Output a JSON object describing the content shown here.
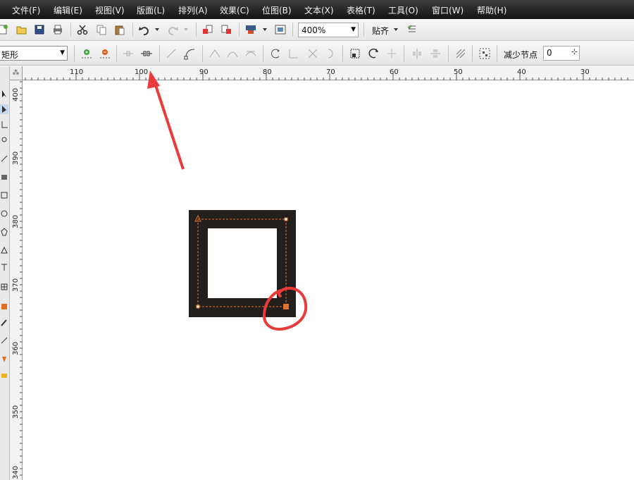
{
  "menu": [
    "文件(F)",
    "编辑(E)",
    "视图(V)",
    "版面(L)",
    "排列(A)",
    "效果(C)",
    "位图(B)",
    "文本(X)",
    "表格(T)",
    "工具(O)",
    "窗口(W)",
    "帮助(H)"
  ],
  "toolbar": {
    "zoom_value": "400%",
    "snap_label": "贴齐"
  },
  "property_bar": {
    "shape_type": "矩形",
    "reduce_nodes_label": "减少节点",
    "reduce_nodes_value": "0"
  },
  "ruler": {
    "horizontal": [
      "110",
      "100",
      "90",
      "80",
      "70",
      "60",
      "50",
      "40",
      "30"
    ],
    "vertical": [
      "400",
      "390",
      "380",
      "370",
      "360",
      "350",
      "340"
    ]
  },
  "colors": {
    "shape_fill": "#231f1d",
    "selection_outline": "#e0702a",
    "annotation_red": "#ea3b3b"
  },
  "icons": {
    "new": "new-document-icon",
    "open": "open-folder-icon",
    "save": "save-icon",
    "print": "print-icon",
    "cut": "cut-icon",
    "copy": "copy-icon",
    "paste": "paste-icon",
    "undo": "undo-icon",
    "redo": "redo-icon",
    "import": "import-icon",
    "export": "export-icon",
    "launcher": "launcher-icon",
    "welcome": "welcome-icon",
    "snap_options": "snap-options-icon"
  }
}
